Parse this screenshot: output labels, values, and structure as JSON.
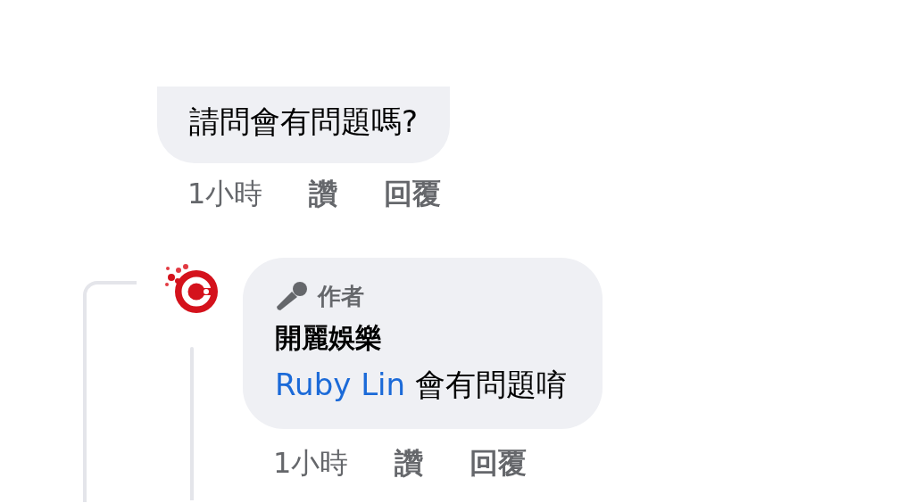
{
  "comment": {
    "text": "請問會有問題嗎?",
    "time": "1小時",
    "like": "讚",
    "reply": "回覆"
  },
  "reply": {
    "badge": "作者",
    "author": "開麗娛樂",
    "mention": "Ruby Lin",
    "text": "會有問題唷",
    "time": "1小時",
    "like": "讚",
    "reply": "回覆"
  }
}
